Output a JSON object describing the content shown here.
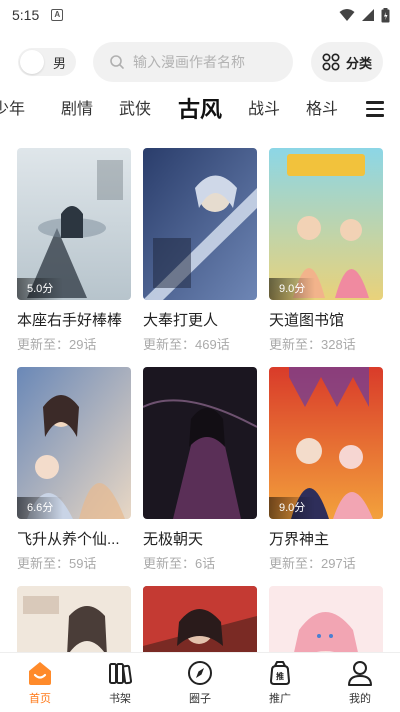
{
  "status_bar": {
    "time": "5:15",
    "app_indicator": "A"
  },
  "top": {
    "gender_label": "男",
    "search_placeholder": "输入漫画作者名称",
    "category_label": "分类"
  },
  "tabs": [
    {
      "label": "少年",
      "active": false
    },
    {
      "label": "剧情",
      "active": false
    },
    {
      "label": "武侠",
      "active": false
    },
    {
      "label": "古风",
      "active": true
    },
    {
      "label": "战斗",
      "active": false
    },
    {
      "label": "格斗",
      "active": false
    }
  ],
  "comics": [
    {
      "title": "本座右手好棒棒",
      "update": "更新至：29话",
      "score": "5.0分",
      "colors": [
        "#dfe6ea",
        "#7b8c99",
        "#2c3640"
      ]
    },
    {
      "title": "大奉打更人",
      "update": "更新至：469话",
      "score": "",
      "colors": [
        "#2a3d6b",
        "#6e86b5",
        "#d9e3f2"
      ]
    },
    {
      "title": "天道图书馆",
      "update": "更新至：328话",
      "score": "9.0分",
      "colors": [
        "#8cd6e6",
        "#e9d27a",
        "#f2b38b"
      ]
    },
    {
      "title": "飞升从养个仙...",
      "update": "更新至：59话",
      "score": "6.6分",
      "colors": [
        "#6a88b7",
        "#e7b98f",
        "#e8d7c4"
      ]
    },
    {
      "title": "无极朝天",
      "update": "更新至：6话",
      "score": "",
      "colors": [
        "#1b1620",
        "#5a2f57",
        "#a77ba6"
      ]
    },
    {
      "title": "万界神主",
      "update": "更新至：297话",
      "score": "9.0分",
      "colors": [
        "#d93b2a",
        "#f3a13c",
        "#6a3f9e"
      ]
    },
    {
      "title": "",
      "update": "",
      "score": "",
      "colors": [
        "#f0e7dc",
        "#b79d87",
        "#4a3d38"
      ]
    },
    {
      "title": "",
      "update": "",
      "score": "",
      "colors": [
        "#c43a33",
        "#7a2a24",
        "#2a1b1b"
      ]
    },
    {
      "title": "",
      "update": "",
      "score": "",
      "colors": [
        "#f7d8d6",
        "#f2a5b3",
        "#fbe9ea"
      ]
    }
  ],
  "bottom_nav": [
    {
      "label": "首页",
      "icon": "home-icon",
      "active": true
    },
    {
      "label": "书架",
      "icon": "bookshelf-icon",
      "active": false
    },
    {
      "label": "圈子",
      "icon": "compass-icon",
      "active": false
    },
    {
      "label": "推广",
      "icon": "promote-bag-icon",
      "active": false
    },
    {
      "label": "我的",
      "icon": "profile-icon",
      "active": false
    }
  ],
  "accent_color": "#ff7a1a"
}
